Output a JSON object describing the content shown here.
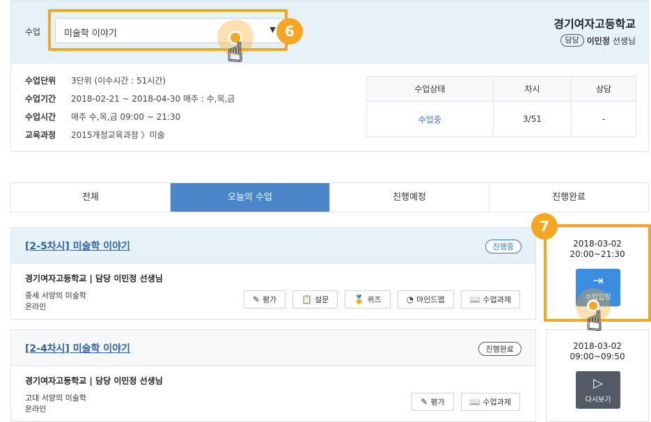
{
  "header": {
    "course_label": "수업",
    "course_select_value": "미술학 이야기",
    "school_name": "경기여자고등학교",
    "role": "담당",
    "teacher_name": "이민정",
    "teacher_suffix": "선생님"
  },
  "annotations": {
    "step1": "6",
    "step2": "7"
  },
  "info": {
    "rows": [
      {
        "key": "수업단위",
        "value": "3단위 (이수시간 : 51시간)"
      },
      {
        "key": "수업기간",
        "value": "2018-02-21 ~ 2018-04-30  매주 : 수,목,금"
      },
      {
        "key": "수업시간",
        "value": "매주 수,목,금 09:00 ~ 21:30"
      },
      {
        "key": "교육과정",
        "value": "2015개정교육과정 〉미술"
      }
    ],
    "stats": {
      "headers": [
        "수업상태",
        "차시",
        "상담"
      ],
      "values": [
        "수업중",
        "3/51",
        "-"
      ]
    }
  },
  "tabs": [
    "전체",
    "오늘의 수업",
    "진행예정",
    "진행완료"
  ],
  "sessions": [
    {
      "title": "[2-5차시] 미술학 이야기",
      "status": "진행중",
      "school_line": "경기여자고등학교 | 담당 이민정 선생님",
      "sub1": "중세 서양의 미술학",
      "sub2": "온라인",
      "actions": [
        "평가",
        "설문",
        "퀴즈",
        "마인드맵",
        "수업과제"
      ],
      "date": "2018-03-02",
      "time": "20:00~21:30",
      "button": "수업입장"
    },
    {
      "title": "[2-4차시] 미술학 이야기",
      "status": "진행완료",
      "school_line": "경기여자고등학교 | 담당 이민정 선생님",
      "sub1": "고대 서양의 미술학",
      "sub2": "온라인",
      "actions": [
        "평가",
        "수업과제"
      ],
      "date": "2018-03-02",
      "time": "09:00~09:50",
      "button": "다시보기"
    }
  ]
}
